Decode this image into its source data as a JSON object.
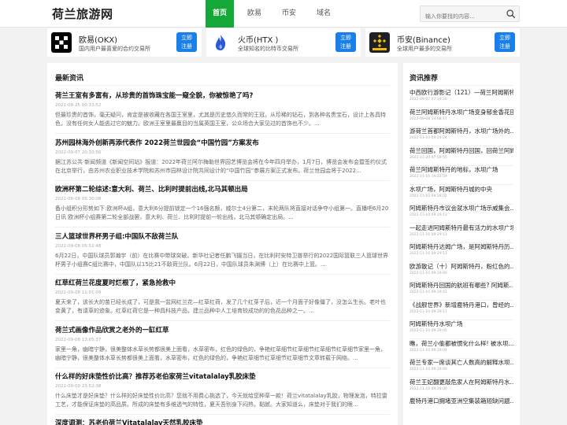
{
  "site": {
    "logo": "荷兰旅游网"
  },
  "nav": {
    "items": [
      "首页",
      "欧易",
      "币安",
      "域名"
    ]
  },
  "search": {
    "placeholder": "输入你要找的内容..."
  },
  "exchanges": [
    {
      "name": "欧易(OKX)",
      "desc": "国内用户最喜爱的合约交易所",
      "button": "立即\n注册",
      "accent": "#000000"
    },
    {
      "name": "火币(HTX )",
      "desc": "全球知名的比特币交易所",
      "button": "立即\n注册",
      "accent": "#2a5ada"
    },
    {
      "name": "币安(Binance)",
      "desc": "全球用户最多的交易所",
      "button": "立即\n注册",
      "accent": "#f0b90b"
    }
  ],
  "news_section": {
    "title": "最新资讯",
    "items": [
      {
        "title": "荷兰王室有多富有，从珍贵的首饰珠宝能一窥全貌，你被惊艳了吗?",
        "date": "2022-08-25 00:33:52",
        "text": "但最珍贵的首饰，毫无疑问，肯定是被收藏在各国王室里，尤其是历史悠久而常的王冠，从珍稀的钻石，到各种名贵宝石，设计上各具特色，没有任何女人能逃过它的魅力。欧洲王室里最赢目的当属英国王室，公众场合大家见过的首饰也不少。..."
      },
      {
        "title": "苏州园林海外创新再添代表作 2022荷兰世园会“中国竹园”方案发布",
        "date": "2022-09-07 20:10:56",
        "text": "据江苏公共·新闻频道《新闻空间站》报道：2022年荷兰阿尔梅勒世界园艺博览会将在今年四月举办，1月7日，博览会发布会暨签约仪式在北京举行，由苏州农业职业技术学院和苏州市园林设计院共同设计的“中国竹园”参展方案正式发布。荷兰世园会将于2022..."
      },
      {
        "title": "欧洲杯第二轮综述:意大利、荷兰、比利时提前出线,北马其顿出局",
        "date": "2022-08-08 05:30:08",
        "text": "备小组积分形势如下:欧洲杯A组，意大利6分提前锁定一个16强名额，威尔士4分第二，末轮两队将直接对话争夺小组第一。直播吧6月20日讯 欧洲杯小组赛第二轮全部战罢，意大利、荷兰、比利时提前一轮出线，北马其顿确定出局。..."
      },
      {
        "title": "三人篮球世界杯男子组:中国队不敌荷兰队",
        "date": "2022-09-08 05:51:48",
        "text": "6月22日，中国队球员郭瀚宇（前）在比赛中带球突破。新华社记者任鹏飞摄当日，在比利时安特卫普举行的2022国际篮联三人篮球世界杯男子小组赛C组比赛中，中国队以15比21不敌荷兰队。6月22日，中国队球员朱渊博（上）在比赛中上篮。..."
      },
      {
        "title": "红草红荷兰花度夏时烂根了，紧急抢救中",
        "date": "2022-09-08 11:01:09",
        "text": "夏天来了，该长大的苗已经长成了，可是我一盆网红兰花—红草红荷，发了几个红芽子后，近一个月面子好像僵了，没怎么生长。老叶也变黄了，有请草的迹象。红草红荷它是一种具科技产品，建兰品种中人工培育较成功的的色花品种之一。..."
      },
      {
        "title": "荷兰式画像作品欣赏之老外的一缸红草",
        "date": "2022-09-08 13:05:37",
        "text": "家里一角，幽暗宁静，很美整体水草长势都很美上面看，水草密布，红色的绿色的，争艳红草细节红草细节红草细节红草细节家里一角，幽暗宁静，很美整体水草长势都很美上面看，水草密布，红色的绿色的，争艳红草细节红草细节红草细节文章转载于网络。..."
      },
      {
        "title": "什么样的好床垫性价比高？推荐苏老伯家荷兰vitatalalay乳胶床垫",
        "date": "2022-09-09 23:52:38",
        "text": "什么床垫才是好床垫？什么样的好床垫性价比高？您就不用费心挑选了，今天就给您种草一款！荷兰vitatalalay乳胶，物理发泡，特拉雷工艺，才能保证床垫的高品质。所成的床垫有多维透气的特性，夏天吾别身下闷热，黏腻。大家知道么，床垫对于我们的眼..."
      },
      {
        "title": "深度调测：苏老伯荷兰Vitatalalay天然乳胶床垫",
        "date": "",
        "text": ""
      }
    ]
  },
  "sidebar": {
    "title": "资讯推荐",
    "items": [
      {
        "title": "中西欧行游影记（121）—荷兰阿姆斯特丹",
        "date": "2022-09-07 07:19:10"
      },
      {
        "title": "荷兰阿姆斯特丹水坝广场变身郁金香花田",
        "date": "2022-09-08 14:08:17"
      },
      {
        "title": "游荷兰首都阿姆斯特丹，水坝广场外的...",
        "date": "2022-11-10 09:24:24"
      },
      {
        "title": "荷兰回国，阿姆斯特丹回国，回荷兰阿姆",
        "date": "2022-11-20 07:59:55"
      },
      {
        "title": "荷兰阿姆斯特丹的地标，水坝广场",
        "date": "2022-11-10 19:22:59"
      },
      {
        "title": "水坝广场，阿姆斯特丹城的中央",
        "date": "2022-11-10 09:28:02"
      },
      {
        "title": "阿姆斯特丹市议会就水坝广场示威集会...",
        "date": "2022-11-10 09:29:13"
      },
      {
        "title": "一起走进阿姆斯特丹最有活力的水坝广场",
        "date": "2022-11-10 09:29:13"
      },
      {
        "title": "阿姆斯特丹达姆广场，是阿姆斯特丹历...",
        "date": "2022-11-10 09:29:13"
      },
      {
        "title": "欧游散记（十）阿姆斯特丹，粉红色的...",
        "date": "2022-11-10 09:29:00"
      },
      {
        "title": "阿姆斯特丹回国的航班有哪些? 阿姆斯...",
        "date": "2022-11-10 09:29:41"
      },
      {
        "title": "《战舰世界》新增鹿特丹港口，曾经的...",
        "date": "2022-11-10 09:29:17"
      },
      {
        "title": "阿姆斯特丹水坝广场",
        "date": "2022-11-10 09:29:05"
      },
      {
        "title": "瞧，荷兰小偷都被惯化什么样!  被水坝...",
        "date": "2022-11-10 09:29:04"
      },
      {
        "title": "荷兰专家一席谈其亡人数高的解释水坝...",
        "date": "2022-11-10 09:29:00"
      },
      {
        "title": "荷兰王妃翻更敲危家人在阿姆斯特丹水...",
        "date": "2022-11-10 09:28:00"
      },
      {
        "title": "鹿特丹港口拥堵亚洲空集装箱短缺问题...",
        "date": ""
      }
    ]
  }
}
